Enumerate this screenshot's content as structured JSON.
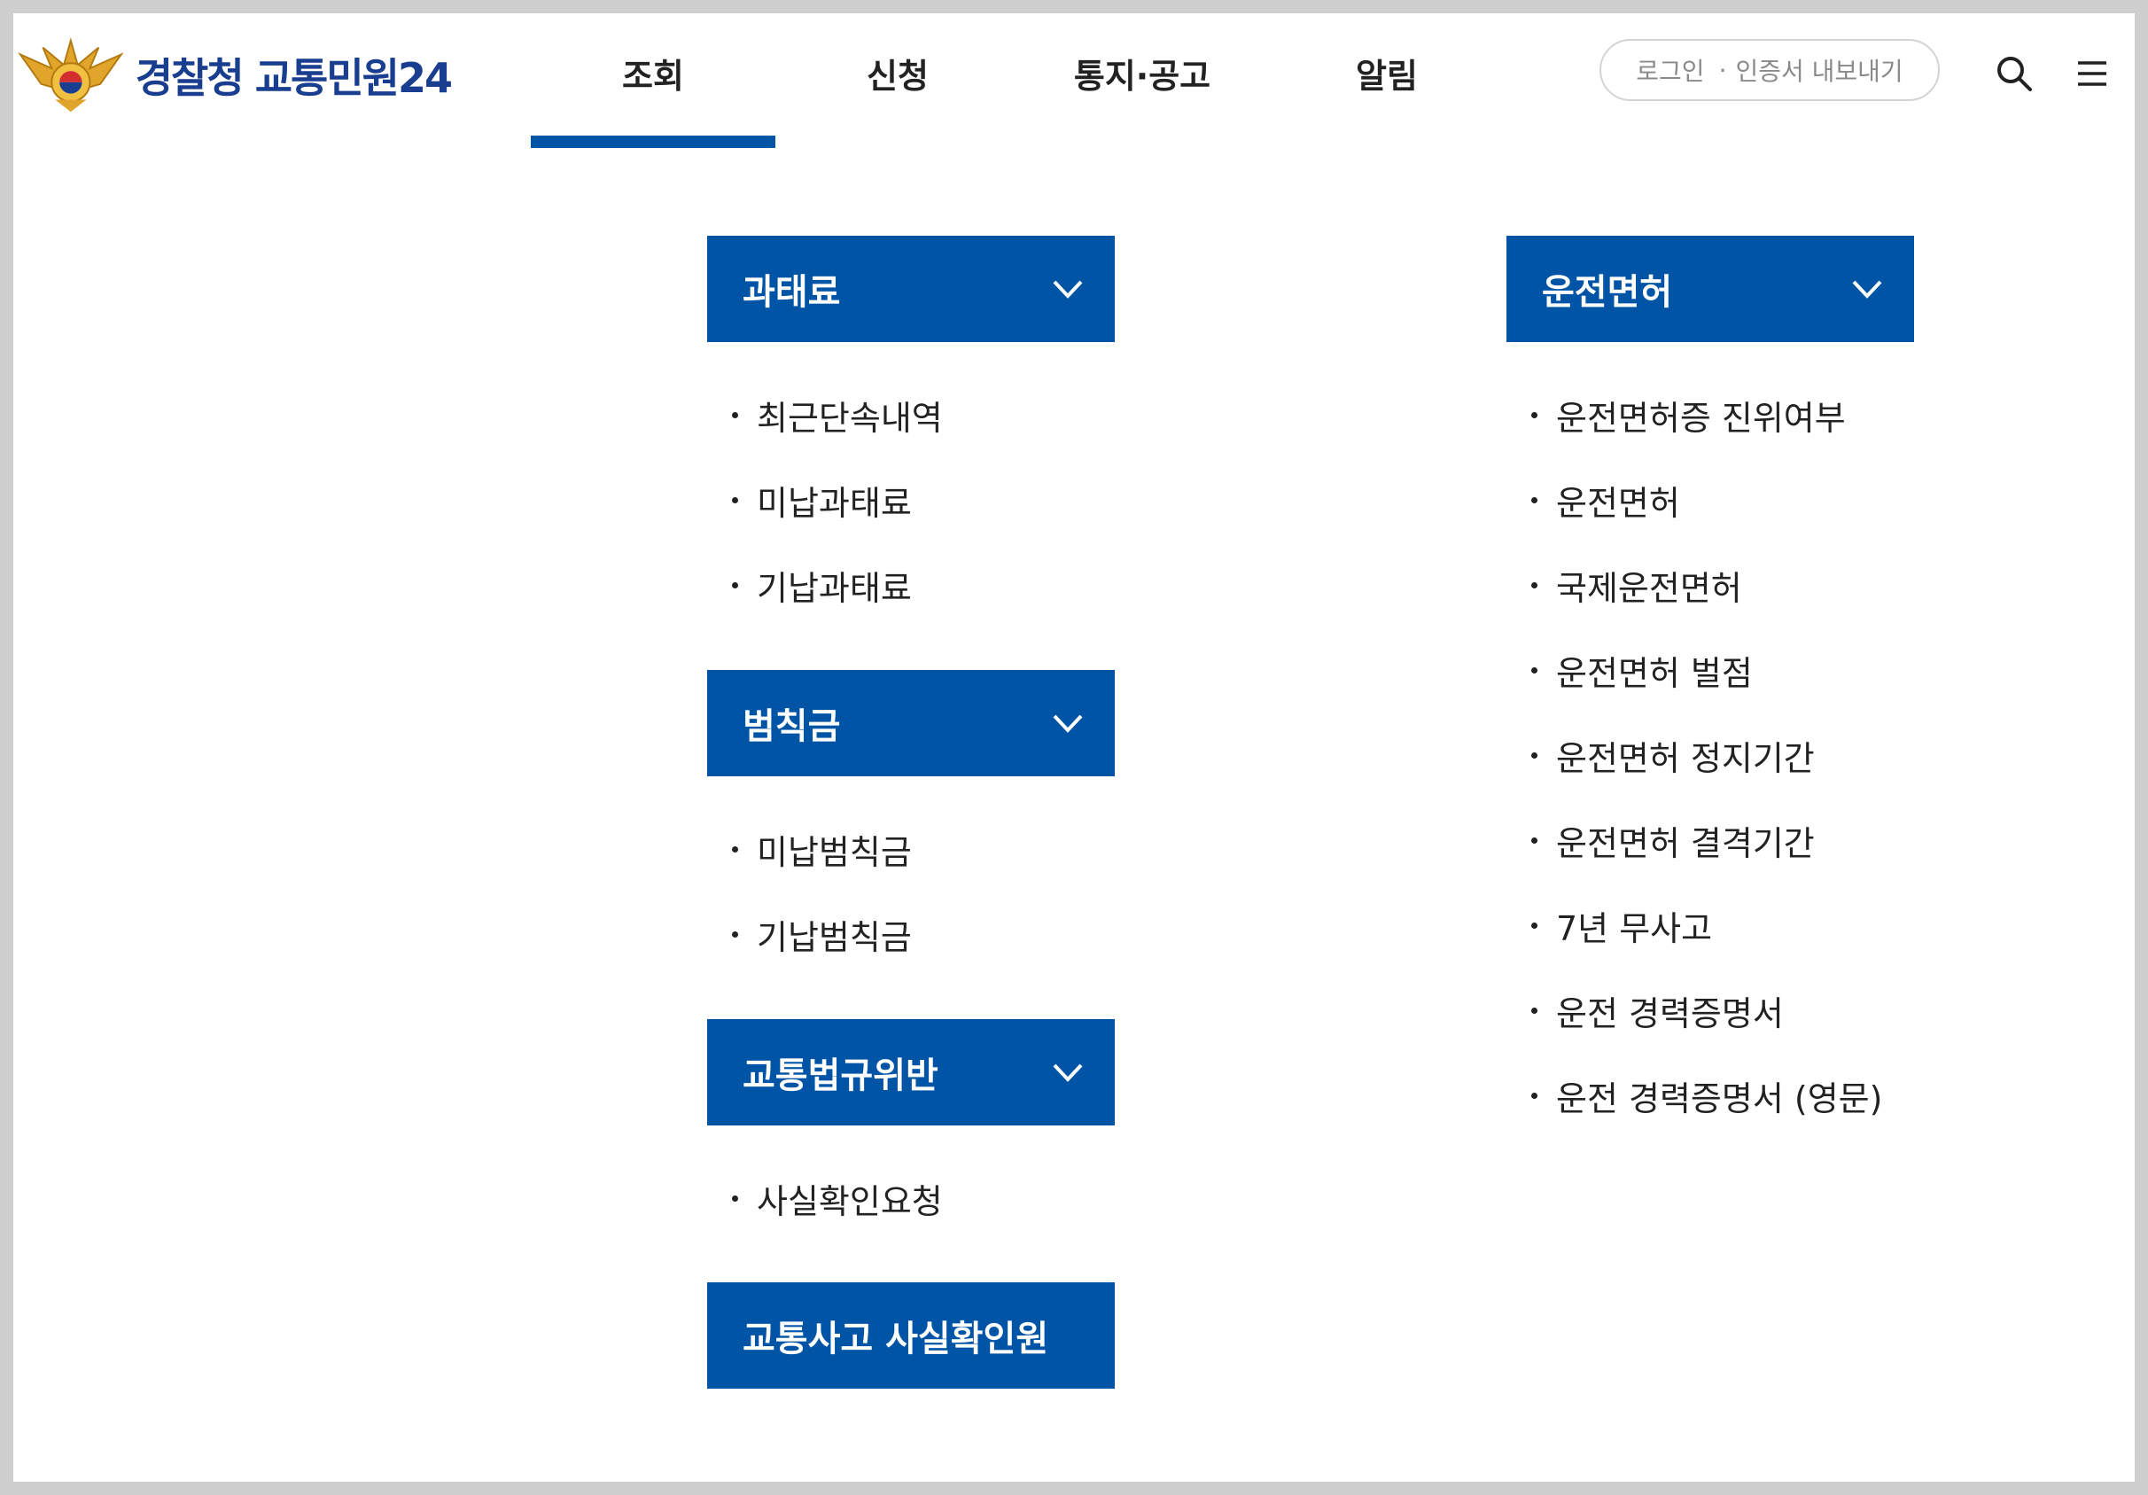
{
  "header": {
    "logo_text": "경찰청 교통민원24",
    "nav": [
      "조회",
      "신청",
      "통지·공고",
      "알림"
    ],
    "login_label": "로그인",
    "cert_label": "인증서 내보내기",
    "search_icon": "search-icon",
    "menu_icon": "menu-icon"
  },
  "groups": {
    "fine": {
      "title": "과태료",
      "items": [
        "최근단속내역",
        "미납과태료",
        "기납과태료"
      ]
    },
    "penalty": {
      "title": "범칙금",
      "items": [
        "미납범칙금",
        "기납범칙금"
      ]
    },
    "violation": {
      "title": "교통법규위반",
      "items": [
        "사실확인요청"
      ]
    },
    "accident": {
      "title": "교통사고 사실확인원"
    },
    "license": {
      "title": "운전면허",
      "items": [
        "운전면허증 진위여부",
        "운전면허",
        "국제운전면허",
        "운전면허 벌점",
        "운전면허 정지기간",
        "운전면허 결격기간",
        "7년 무사고",
        "운전 경력증명서",
        "운전 경력증명서 (영문)"
      ]
    }
  },
  "colors": {
    "primary": "#0054a6",
    "logo_text": "#1a3e8f"
  }
}
